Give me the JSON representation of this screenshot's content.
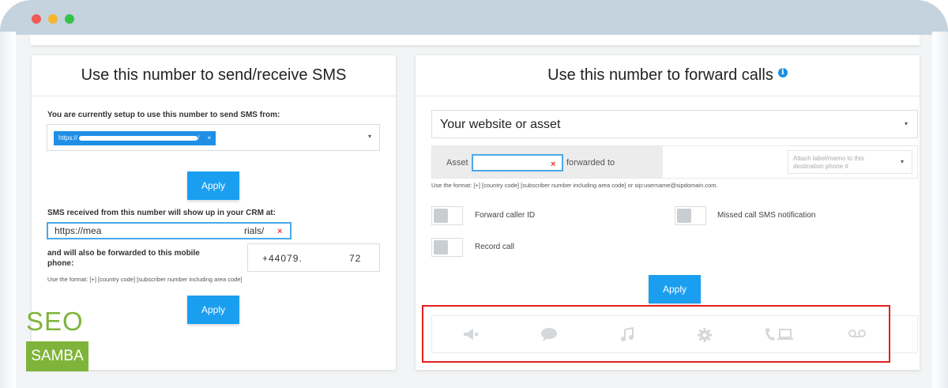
{
  "sms_panel": {
    "title": "Use this number to send/receive SMS",
    "setup_label": "You are currently setup to use this number to send SMS from:",
    "setup_tag_prefix": "https://",
    "setup_tag_suffix": "/",
    "apply_label": "Apply",
    "crm_label": "SMS received from this number will show up in your CRM at:",
    "crm_url_start": "https://mea",
    "crm_url_end": "rials/",
    "forward_label_line1": "and will also be forwarded to this mobile",
    "forward_label_line2": "phone:",
    "phone_start": "+44079.",
    "phone_end": "72",
    "format_hint": "Use the format: [+] [country code] [subscriber number including area code]",
    "apply2_label": "Apply"
  },
  "calls_panel": {
    "title": "Use this number to forward calls",
    "info_icon": "i",
    "asset_select": "Your website or asset",
    "asset_label": "Asset",
    "forwarded_to": "forwarded to",
    "memo_placeholder_line1": "Attach label/memo to this",
    "memo_placeholder_line2": "destination phone #",
    "format_hint": "Use the format: [+] [country code] [subscriber number including area code] or sip:username@sipdomain.com.",
    "forward_caller_id": "Forward caller ID",
    "missed_call_sms": "Missed call SMS notification",
    "record_call": "Record call",
    "apply_label": "Apply"
  },
  "icons": {
    "clear": "×",
    "chevron": "▾"
  },
  "icon_bar": [
    "megaphone-icon",
    "chat-icon",
    "music-icon",
    "gear-icon",
    "phone-laptop-icon",
    "voicemail-icon"
  ],
  "logo": {
    "line1": "SEO",
    "line2": "SAMBA"
  },
  "colors": {
    "accent": "#1a9ff0",
    "logo_green": "#7fb43a",
    "highlight_red": "#e32020"
  }
}
